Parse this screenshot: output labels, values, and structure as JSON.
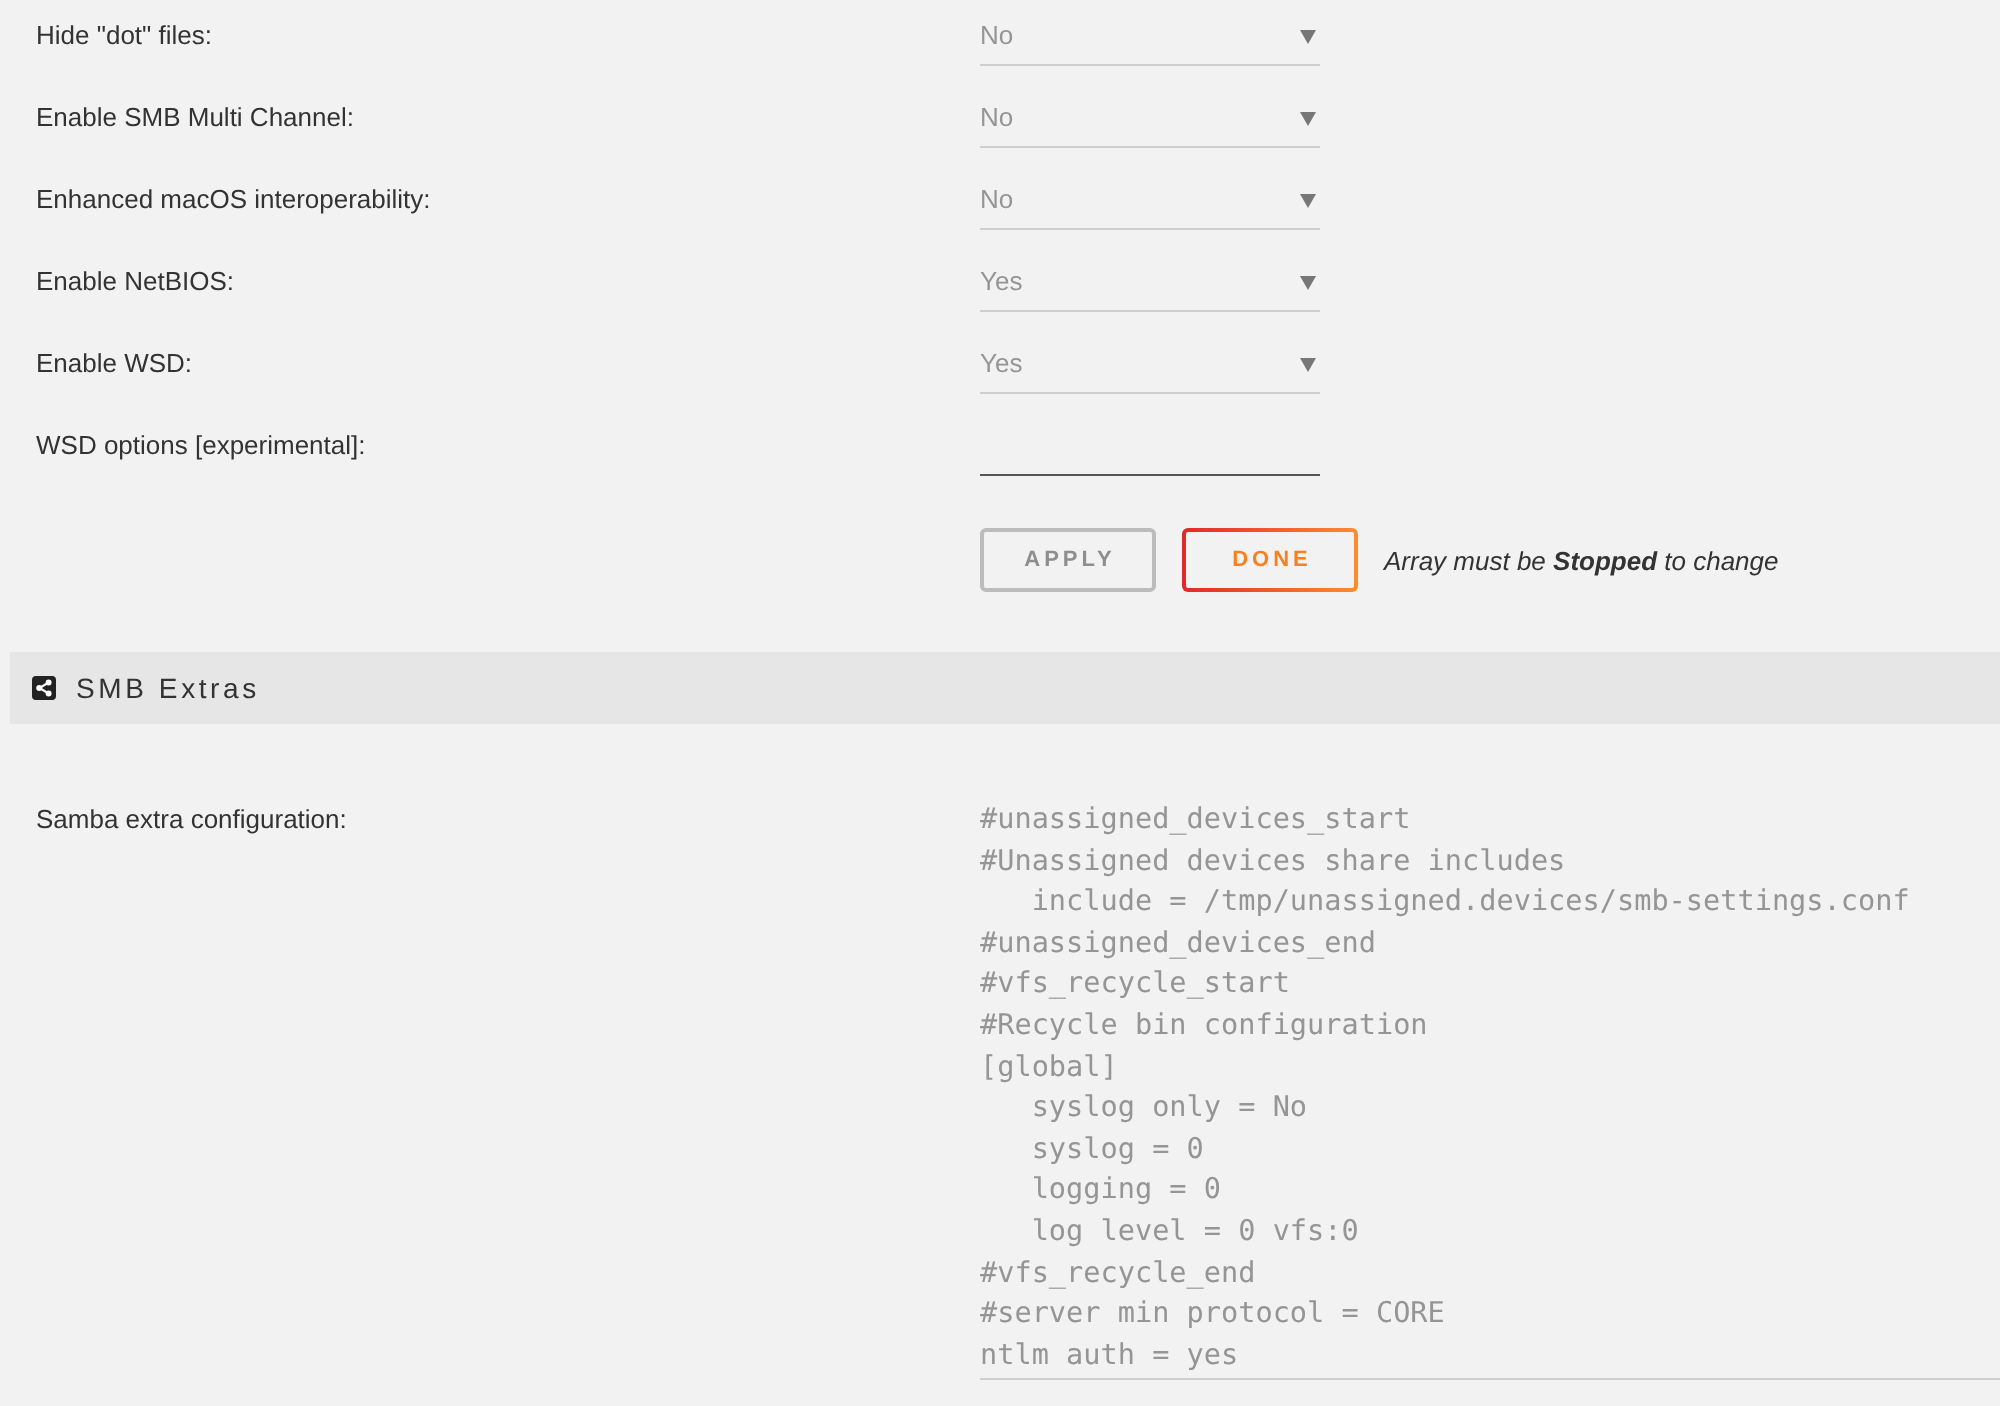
{
  "settings": [
    {
      "label": "Hide \"dot\" files:",
      "kind": "select",
      "value": "No"
    },
    {
      "label": "Enable SMB Multi Channel:",
      "kind": "select",
      "value": "No"
    },
    {
      "label": "Enhanced macOS interoperability:",
      "kind": "select",
      "value": "No"
    },
    {
      "label": "Enable NetBIOS:",
      "kind": "select",
      "value": "Yes"
    },
    {
      "label": "Enable WSD:",
      "kind": "select",
      "value": "Yes"
    },
    {
      "label": "WSD options [experimental]:",
      "kind": "text"
    }
  ],
  "actions": {
    "buttons": [
      {
        "label": "APPLY",
        "disabled": true
      },
      {
        "label": "DONE",
        "disabled": false
      }
    ],
    "note": "Array must be **Stopped** to change"
  },
  "section": {
    "title": "SMB Extras"
  },
  "extra_config": {
    "label": "Samba extra configuration:",
    "lines": [
      "#unassigned_devices_start",
      "#Unassigned devices share includes",
      "   include = /tmp/unassigned.devices/smb-settings.conf",
      "#unassigned_devices_end",
      "#vfs_recycle_start",
      "#Recycle bin configuration",
      "[global]",
      "   syslog only = No",
      "   syslog = 0",
      "   logging = 0",
      "   log level = 0 vfs:0",
      "#vfs_recycle_end",
      "#server min protocol = CORE",
      "ntlm auth = yes"
    ]
  }
}
